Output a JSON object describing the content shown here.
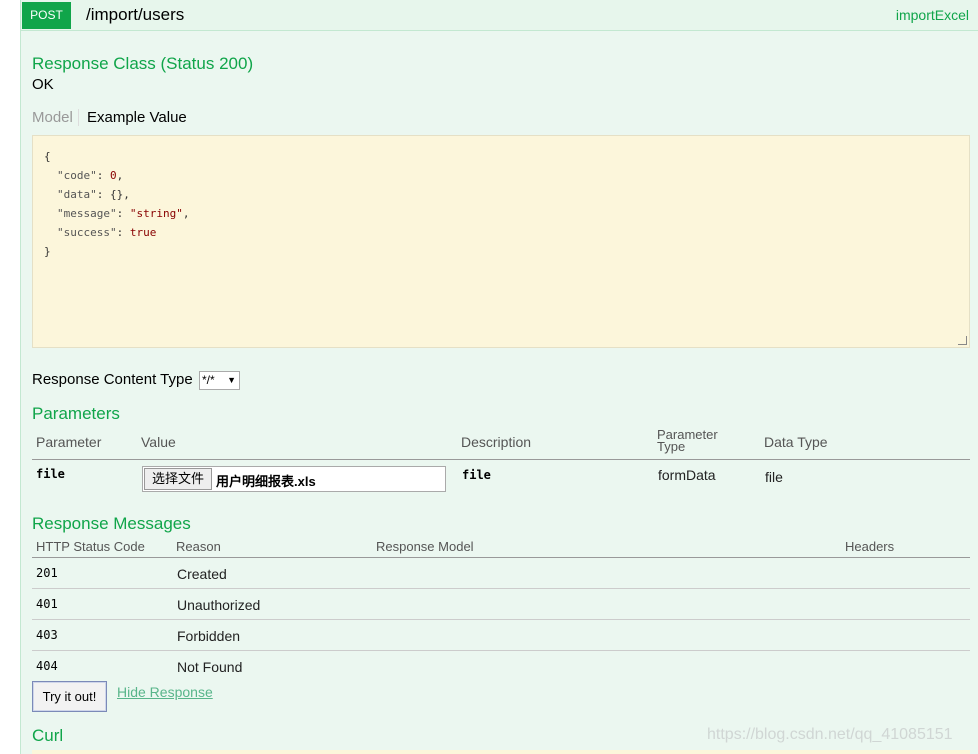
{
  "operation": {
    "method": "POST",
    "path": "/import/users",
    "nickname": "importExcel"
  },
  "response_class": {
    "title": "Response Class (Status 200)",
    "status_text": "OK"
  },
  "model_tabs": {
    "model": "Model",
    "example": "Example Value"
  },
  "example_json": {
    "open": "{",
    "lines": [
      {
        "key": "\"code\"",
        "value": "0",
        "sep": ","
      },
      {
        "key": "\"data\"",
        "value": "{}",
        "sep": ","
      },
      {
        "key": "\"message\"",
        "value": "\"string\"",
        "sep": ","
      },
      {
        "key": "\"success\"",
        "value": "true",
        "sep": ""
      }
    ],
    "close": "}"
  },
  "content_type": {
    "label": "Response Content Type",
    "selected": "*/*"
  },
  "parameters": {
    "title": "Parameters",
    "headers": {
      "parameter": "Parameter",
      "value": "Value",
      "description": "Description",
      "param_type_1": "Parameter",
      "param_type_2": "Type",
      "data_type": "Data Type"
    },
    "row": {
      "name": "file",
      "choose_label": "选择文件",
      "file_name": "用户明细报表.xls",
      "description": "file",
      "param_type": "formData",
      "data_type": "file"
    }
  },
  "response_messages": {
    "title": "Response Messages",
    "headers": {
      "code": "HTTP Status Code",
      "reason": "Reason",
      "model": "Response Model",
      "headers": "Headers"
    },
    "rows": [
      {
        "code": "201",
        "reason": "Created"
      },
      {
        "code": "401",
        "reason": "Unauthorized"
      },
      {
        "code": "403",
        "reason": "Forbidden"
      },
      {
        "code": "404",
        "reason": "Not Found"
      }
    ]
  },
  "actions": {
    "try": "Try it out!",
    "hide": "Hide Response"
  },
  "curl": {
    "title": "Curl"
  },
  "watermark": "https://blog.csdn.net/qq_41085151"
}
